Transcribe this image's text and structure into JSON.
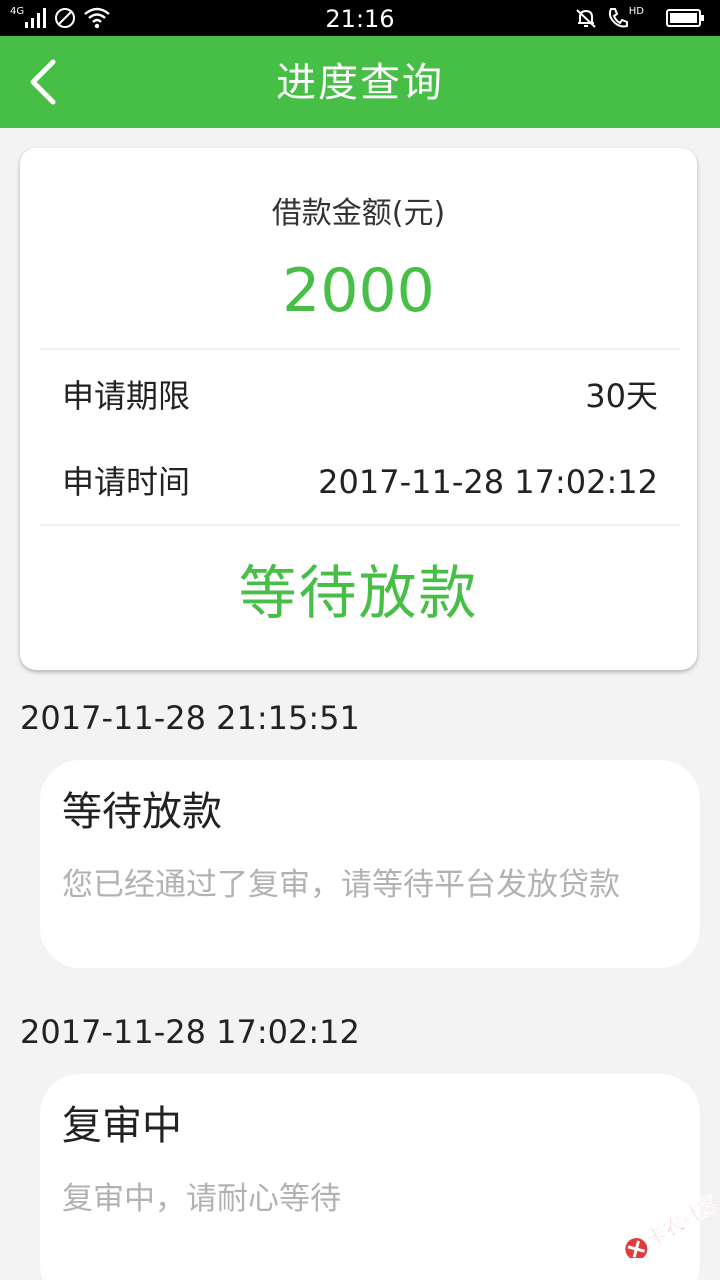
{
  "status_bar": {
    "network": "4G",
    "time": "21:16",
    "hd": "HD"
  },
  "header": {
    "title": "进度查询"
  },
  "summary": {
    "amount_label": "借款金额(元)",
    "amount": "2000",
    "term_label": "申请期限",
    "term_value": "30天",
    "time_label": "申请时间",
    "time_value": "2017-11-28 17:02:12",
    "status": "等待放款"
  },
  "timeline": [
    {
      "date": "2017-11-28 21:15:51",
      "title": "等待放款",
      "desc": "您已经通过了复审，请等待平台发放贷款"
    },
    {
      "date": "2017-11-28 17:02:12",
      "title": "复审中",
      "desc": "复审中，请耐心等待"
    }
  ],
  "watermark": {
    "text": "卡农社区"
  },
  "colors": {
    "accent": "#47bf47",
    "background": "#f3f3f3",
    "muted_text": "#b2b2b2"
  }
}
